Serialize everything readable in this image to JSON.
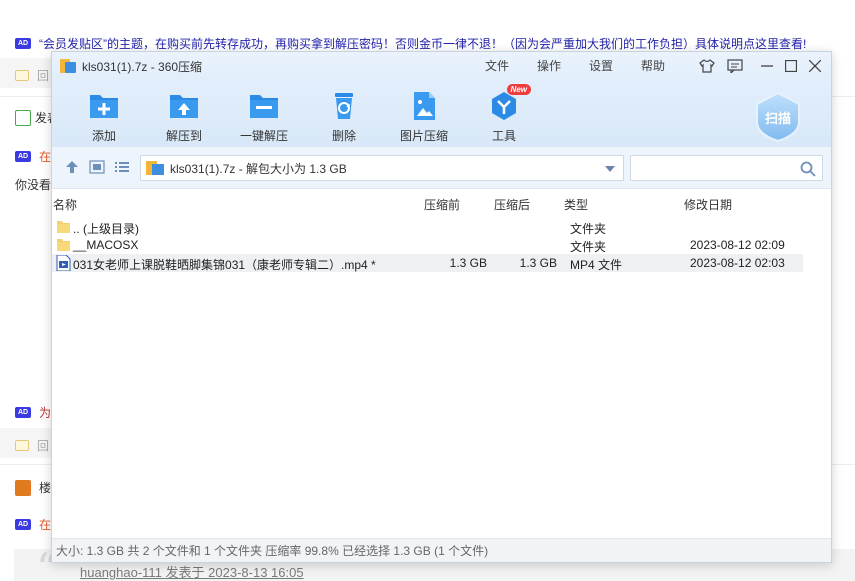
{
  "background_page": {
    "top_notice": "“会员发贴区”的主题，在购买前先转存成功，再购买拿到解压密码！否则金币一律不退！（因为会严重加大我们的工作负担）具体说明点这里查看!",
    "ad_badge": "AD",
    "reply_label": "回",
    "row_post_label": "发表",
    "row_ad_text_1": "在",
    "row_text_2": "你没看",
    "row_ad_text_3": "为i",
    "row_floor_label": "楼",
    "row_ad_text_4": "在",
    "quote_author": "huanghao-111 发表于 2023-8-13 16:05"
  },
  "window": {
    "title": "kls031(1).7z - 360压缩",
    "menu": [
      "文件",
      "操作",
      "设置",
      "帮助"
    ],
    "toolbar": [
      {
        "label": "添加",
        "icon": "add-icon"
      },
      {
        "label": "解压到",
        "icon": "extract-to-icon"
      },
      {
        "label": "一键解压",
        "icon": "one-click-extract-icon"
      },
      {
        "label": "删除",
        "icon": "delete-icon"
      },
      {
        "label": "图片压缩",
        "icon": "image-compress-icon"
      },
      {
        "label": "工具",
        "icon": "tools-icon",
        "badge": "New"
      }
    ],
    "scan_label": "扫描",
    "address": "kls031(1).7z - 解包大小为 1.3 GB",
    "search_placeholder": "",
    "columns": {
      "name": "名称",
      "before": "压缩前",
      "after": "压缩后",
      "type": "类型",
      "modified": "修改日期"
    },
    "files": [
      {
        "name": ".. (上级目录)",
        "before": "",
        "after": "",
        "type": "文件夹",
        "modified": "",
        "kind": "folder"
      },
      {
        "name": "__MACOSX",
        "before": "",
        "after": "",
        "type": "文件夹",
        "modified": "2023-08-12 02:09",
        "kind": "folder"
      },
      {
        "name": "031女老师上课脱鞋晒脚集锦031（康老师专辑二）.mp4 *",
        "before": "1.3 GB",
        "after": "1.3 GB",
        "type": "MP4 文件",
        "modified": "2023-08-12 02:03",
        "kind": "file",
        "selected": true
      }
    ],
    "status": "大小: 1.3 GB 共 2 个文件和 1 个文件夹 压缩率 99.8% 已经选择 1.3 GB (1 个文件)"
  },
  "colors": {
    "accent": "#2b8ae6",
    "toolbar_bg": "#dceaf9",
    "ad_badge": "#3a3ae0",
    "new_badge": "#ef3d3d"
  }
}
